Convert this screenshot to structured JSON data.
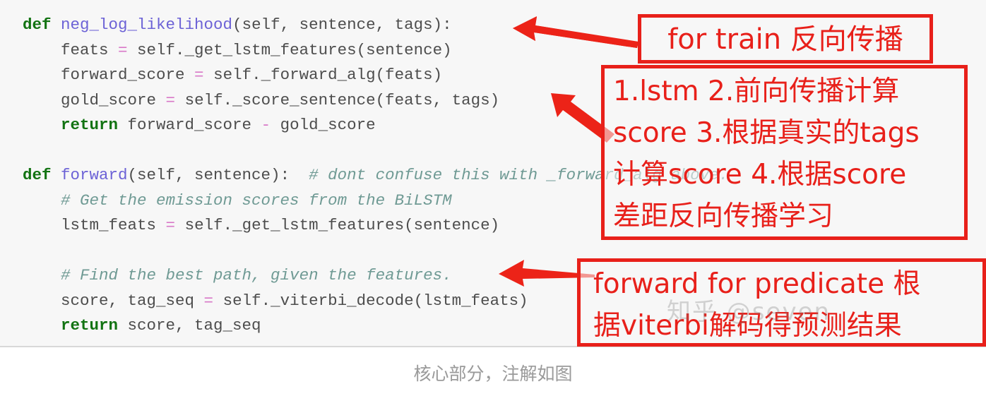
{
  "code_block": {
    "language": "python",
    "background_color": "#f7f7f7",
    "colors": {
      "keyword": "#127312",
      "function_name": "#6c62d6",
      "operator": "#d878c8",
      "plain": "#4d4d4d",
      "comment": "#6f9a94"
    },
    "lines": [
      [
        {
          "t": "def ",
          "c": "kw"
        },
        {
          "t": "neg_log_likelihood",
          "c": "fn"
        },
        {
          "t": "(self, sentence, tags):",
          "c": "plain"
        }
      ],
      [
        {
          "t": "    feats ",
          "c": "plain"
        },
        {
          "t": "=",
          "c": "op"
        },
        {
          "t": " self._get_lstm_features(sentence)",
          "c": "plain"
        }
      ],
      [
        {
          "t": "    forward_score ",
          "c": "plain"
        },
        {
          "t": "=",
          "c": "op"
        },
        {
          "t": " self._forward_alg(feats)",
          "c": "plain"
        }
      ],
      [
        {
          "t": "    gold_score ",
          "c": "plain"
        },
        {
          "t": "=",
          "c": "op"
        },
        {
          "t": " self._score_sentence(feats, tags)",
          "c": "plain"
        }
      ],
      [
        {
          "t": "    return",
          "c": "kw"
        },
        {
          "t": " forward_score ",
          "c": "plain"
        },
        {
          "t": "-",
          "c": "op"
        },
        {
          "t": " gold_score",
          "c": "plain"
        }
      ],
      [],
      [
        {
          "t": "def ",
          "c": "kw"
        },
        {
          "t": "forward",
          "c": "fn"
        },
        {
          "t": "(self, sentence):  ",
          "c": "plain"
        },
        {
          "t": "# dont confuse this with _forward_alg above.",
          "c": "cmt"
        }
      ],
      [
        {
          "t": "    # Get the emission scores from the BiLSTM",
          "c": "cmt"
        }
      ],
      [
        {
          "t": "    lstm_feats ",
          "c": "plain"
        },
        {
          "t": "=",
          "c": "op"
        },
        {
          "t": " self._get_lstm_features(sentence)",
          "c": "plain"
        }
      ],
      [],
      [
        {
          "t": "    # Find the best path, given the features.",
          "c": "cmt"
        }
      ],
      [
        {
          "t": "    score, tag_seq ",
          "c": "plain"
        },
        {
          "t": "=",
          "c": "op"
        },
        {
          "t": " self._viterbi_decode(lstm_feats)",
          "c": "plain"
        }
      ],
      [
        {
          "t": "    return",
          "c": "kw"
        },
        {
          "t": " score, tag_seq",
          "c": "plain"
        }
      ]
    ]
  },
  "annotations": {
    "color": "#e8201a",
    "boxes": [
      {
        "id": "train",
        "text": "for train 反向传播",
        "lines": [
          "for train 反向传播"
        ]
      },
      {
        "id": "steps",
        "text": "1.lstm 2.前向传播计算score 3.根据真实的tags计算score 4.根据score差距反向传播学习",
        "lines": [
          "1.lstm 2.前向传播计算",
          "score 3.根据真实的tags",
          "计算score 4.根据score",
          "差距反向传播学习"
        ]
      },
      {
        "id": "predict",
        "text": "forward for predicate 根据viterbi解码得预测结果",
        "lines": [
          "forward for predicate 根",
          "据viterbi解码得预测结果"
        ]
      }
    ],
    "arrows": [
      {
        "id": "arrow-to-neg-log-likelihood",
        "direction": "left"
      },
      {
        "id": "arrow-to-gold-score",
        "direction": "up-left"
      },
      {
        "id": "arrow-to-find-best-path",
        "direction": "left"
      }
    ]
  },
  "watermark": {
    "text": "知乎 @seven"
  },
  "caption": {
    "text": "核心部分，注解如图"
  }
}
